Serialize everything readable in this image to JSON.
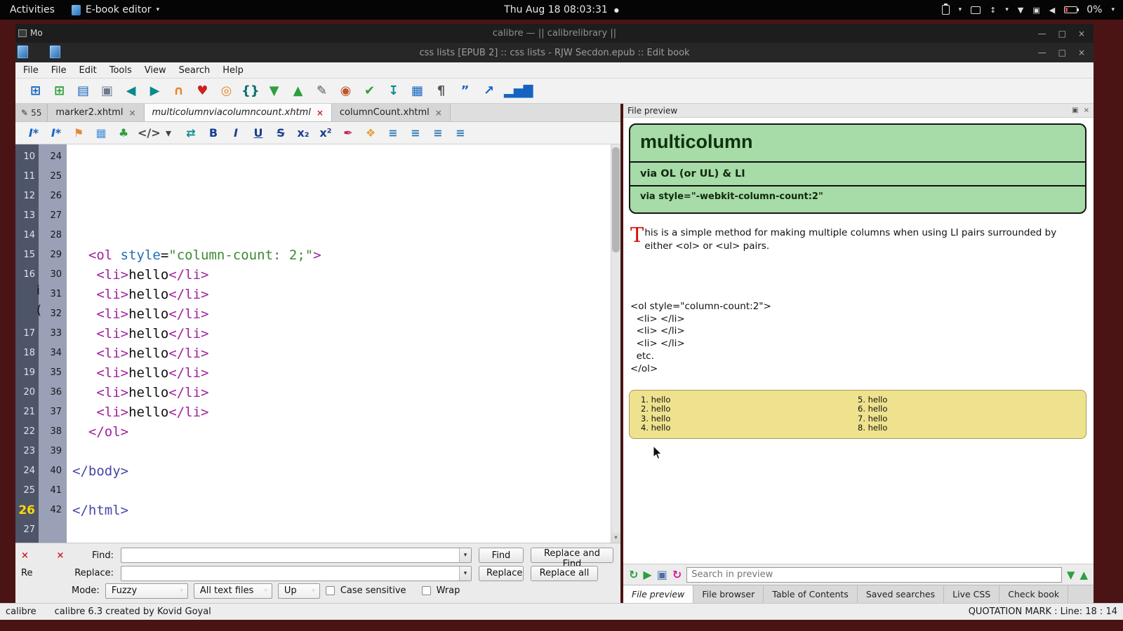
{
  "ui": {
    "chevron_down": "▾",
    "dot": "●",
    "minimize": "—",
    "maximize": "□",
    "close": "×",
    "pen": "✎",
    "down_arrow": "▼",
    "up_arrow": "▲",
    "updown": "↕",
    "net": "▼",
    "cam": "▣",
    "vol": "◀",
    "panel_grid": "▣",
    "panel_close": "×"
  },
  "topbar": {
    "activities": "Activities",
    "app_menu": "E-book editor",
    "clock": "Thu Aug 18 08:03:31",
    "battery_percent": "0%"
  },
  "titlebars": {
    "calibre": "calibre — || calibrelibrary ||",
    "editor": "css lists [EPUB 2] :: css lists - RJW Secdon.epub :: Edit book",
    "background_window_label": "Mo"
  },
  "menubar": {
    "items": [
      "File",
      "File",
      "Edit",
      "Tools",
      "View",
      "Search",
      "Help"
    ]
  },
  "main_toolbar": {
    "icons": [
      {
        "name": "add-book-icon",
        "glyph": "⊞",
        "color": "#1565c0"
      },
      {
        "name": "new-file-icon",
        "glyph": "⊞",
        "color": "#2e9e3f"
      },
      {
        "name": "open-book-icon",
        "glyph": "▤",
        "color": "#1565c0"
      },
      {
        "name": "save-icon",
        "glyph": "▣",
        "color": "#6b7a8c"
      },
      {
        "name": "back-icon",
        "glyph": "◀",
        "color": "#0a8a8a"
      },
      {
        "name": "forward-icon",
        "glyph": "▶",
        "color": "#0a8a8a"
      },
      {
        "name": "arc-icon",
        "glyph": "∩",
        "color": "#e8852c"
      },
      {
        "name": "donate-icon",
        "glyph": "♥",
        "color": "#cc2222"
      },
      {
        "name": "donut-icon",
        "glyph": "◎",
        "color": "#e8852c"
      },
      {
        "name": "braces-icon",
        "glyph": "{}",
        "color": "#0a7070"
      },
      {
        "name": "arrow-down-icon",
        "glyph": "▼",
        "color": "#2e9e3f"
      },
      {
        "name": "arrow-up-icon",
        "glyph": "▲",
        "color": "#2e9e3f"
      },
      {
        "name": "edit-icon",
        "glyph": "✎",
        "color": "#555555"
      },
      {
        "name": "bug-icon",
        "glyph": "◉",
        "color": "#c0522a"
      },
      {
        "name": "spellcheck-icon",
        "glyph": "✔",
        "color": "#2e9e3f"
      },
      {
        "name": "insert-icon",
        "glyph": "↧",
        "color": "#0a8a8a"
      },
      {
        "name": "image-icon",
        "glyph": "▦",
        "color": "#1565c0"
      },
      {
        "name": "paragraph-icon",
        "glyph": "¶",
        "color": "#555555"
      },
      {
        "name": "quote-icon",
        "glyph": "”",
        "color": "#1565c0"
      },
      {
        "name": "upload-icon",
        "glyph": "↗",
        "color": "#1565c0"
      },
      {
        "name": "chart-icon",
        "glyph": "▂▅▇",
        "color": "#1565c0"
      }
    ]
  },
  "tabbar": {
    "partial_tab": "55",
    "tabs": [
      {
        "label": "marker2.xhtml"
      },
      {
        "label": "multicolumnviacolumncount.xhtml",
        "cls": "active"
      },
      {
        "label": "columnCount.xhtml"
      }
    ]
  },
  "format_toolbar": {
    "icons": [
      {
        "name": "insert-link-icon",
        "glyph": "I*",
        "color": "#1565c0",
        "cls": "i"
      },
      {
        "name": "insert-anchor-icon",
        "glyph": "I*",
        "color": "#1565c0",
        "cls": "i"
      },
      {
        "name": "pin-icon",
        "glyph": "⚑",
        "color": "#e8852c"
      },
      {
        "name": "insert-image-icon",
        "glyph": "▦",
        "color": "#4a90d9"
      },
      {
        "name": "plant-icon",
        "glyph": "♣",
        "color": "#2e9e3f"
      },
      {
        "name": "code-tag-icon",
        "glyph": "</>",
        "color": "#444444"
      },
      {
        "name": "chevron-down-icon",
        "glyph": "▾",
        "color": "#444444"
      },
      {
        "name": "split-view-icon",
        "glyph": "⇄",
        "color": "#0a8a8a"
      },
      {
        "name": "bold-icon",
        "glyph": "B",
        "color": "#1a3f8f",
        "cls": "b"
      },
      {
        "name": "italic-icon",
        "glyph": "I",
        "color": "#1a3f8f",
        "cls": "i"
      },
      {
        "name": "underline-icon",
        "glyph": "U",
        "color": "#1a3f8f",
        "cls": "u"
      },
      {
        "name": "strikethrough-icon",
        "glyph": "S",
        "color": "#1a3f8f",
        "cls": "s"
      },
      {
        "name": "subscript-icon",
        "glyph": "x₂",
        "color": "#1a3f8f"
      },
      {
        "name": "superscript-icon",
        "glyph": "x²",
        "color": "#1a3f8f"
      },
      {
        "name": "brush-icon",
        "glyph": "✒",
        "color": "#c2185b"
      },
      {
        "name": "palette-icon",
        "glyph": "❖",
        "color": "#e8a13c"
      },
      {
        "name": "align-left-icon",
        "glyph": "≡",
        "color": "#2a7ab5"
      },
      {
        "name": "align-center-icon",
        "glyph": "≡",
        "color": "#2a7ab5"
      },
      {
        "name": "align-right-icon",
        "glyph": "≡",
        "color": "#2a7ab5"
      },
      {
        "name": "align-justify-icon",
        "glyph": "≡",
        "color": "#2a7ab5"
      }
    ]
  },
  "editor": {
    "left_gutter": [
      {
        "n": "10"
      },
      {
        "n": "11"
      },
      {
        "n": "12"
      },
      {
        "n": "13"
      },
      {
        "n": "14"
      },
      {
        "n": "15"
      },
      {
        "n": "16"
      },
      {
        "n": ""
      },
      {
        "n": ""
      },
      {
        "n": "17"
      },
      {
        "n": "18"
      },
      {
        "n": "19"
      },
      {
        "n": "20"
      },
      {
        "n": "21"
      },
      {
        "n": "22"
      },
      {
        "n": "23"
      },
      {
        "n": "24"
      },
      {
        "n": "25"
      },
      {
        "n": "26",
        "cls": "hl"
      },
      {
        "n": "27"
      }
    ],
    "stray_glyphs": [
      "i",
      "("
    ],
    "line_numbers": [
      "24",
      "25",
      "26",
      "27",
      "28",
      "29",
      "30",
      "31",
      "32",
      "33",
      "34",
      "35",
      "36",
      "37",
      "38",
      "39",
      "40",
      "41",
      "42"
    ],
    "code_lines": [
      [],
      [],
      [],
      [],
      [],
      [
        {
          "c": "tag",
          "t": "  <ol "
        },
        {
          "c": "attr",
          "t": "style"
        },
        {
          "c": "txt",
          "t": "="
        },
        {
          "c": "str",
          "t": "\"column-count: 2;\""
        },
        {
          "c": "tag",
          "t": ">"
        }
      ],
      [
        {
          "c": "tag",
          "t": "   <li>"
        },
        {
          "c": "txt",
          "t": "hello"
        },
        {
          "c": "tag",
          "t": "</li>"
        }
      ],
      [
        {
          "c": "tag",
          "t": "   <li>"
        },
        {
          "c": "txt",
          "t": "hello"
        },
        {
          "c": "tag",
          "t": "</li>"
        }
      ],
      [
        {
          "c": "tag",
          "t": "   <li>"
        },
        {
          "c": "txt",
          "t": "hello"
        },
        {
          "c": "tag",
          "t": "</li>"
        }
      ],
      [
        {
          "c": "tag",
          "t": "   <li>"
        },
        {
          "c": "txt",
          "t": "hello"
        },
        {
          "c": "tag",
          "t": "</li>"
        }
      ],
      [
        {
          "c": "tag",
          "t": "   <li>"
        },
        {
          "c": "txt",
          "t": "hello"
        },
        {
          "c": "tag",
          "t": "</li>"
        }
      ],
      [
        {
          "c": "tag",
          "t": "   <li>"
        },
        {
          "c": "txt",
          "t": "hello"
        },
        {
          "c": "tag",
          "t": "</li>"
        }
      ],
      [
        {
          "c": "tag",
          "t": "   <li>"
        },
        {
          "c": "txt",
          "t": "hello"
        },
        {
          "c": "tag",
          "t": "</li>"
        }
      ],
      [
        {
          "c": "tag",
          "t": "   <li>"
        },
        {
          "c": "txt",
          "t": "hello"
        },
        {
          "c": "tag",
          "t": "</li>"
        }
      ],
      [
        {
          "c": "tag",
          "t": "  </ol>"
        }
      ],
      [],
      [
        {
          "c": "tag2",
          "t": "</body>"
        }
      ],
      [],
      [
        {
          "c": "tag2",
          "t": "</html>"
        }
      ]
    ]
  },
  "find_panel": {
    "partial_row2": "Re",
    "find_label": "Find:",
    "replace_label": "Replace:",
    "find_button": "Find",
    "replace_and_find_button": "Replace and Find",
    "replace_button": "Replace",
    "replace_all_button": "Replace all",
    "mode_label": "Mode:",
    "mode_value": "Fuzzy",
    "scope_value": "All text files",
    "direction_value": "Up",
    "case_sensitive_label": "Case sensitive",
    "wrap_label": "Wrap"
  },
  "preview": {
    "header": "File preview",
    "hero": {
      "title": "multicolumn",
      "sub1": "via OL (or UL) & LI",
      "sub2": "via style=\"-webkit-column-count:2\""
    },
    "para": {
      "dropcap": "T",
      "text": "his is a simple method for making multiple columns when using LI pairs surrounded by either <ol> or <ul> pairs."
    },
    "code_block": [
      "<ol style=\"column-count:2\">",
      "  <li> </li>",
      "  <li> </li>",
      "  <li> </li>",
      "  etc.",
      "</ol>"
    ],
    "list_left": [
      "1. hello",
      "2. hello",
      "3. hello",
      "4. hello"
    ],
    "list_right": [
      "5. hello",
      "6. hello",
      "7. hello",
      "8. hello"
    ],
    "search_placeholder": "Search in preview",
    "search_icons": [
      {
        "name": "refresh-preview-icon",
        "glyph": "↻",
        "color": "#2e9e3f"
      },
      {
        "name": "run-preview-icon",
        "glyph": "▶",
        "color": "#2e9e3f"
      },
      {
        "name": "save-preview-icon",
        "glyph": "▣",
        "color": "#4a6fa5"
      },
      {
        "name": "reload-preview-icon",
        "glyph": "↻",
        "color": "#d81b9a"
      }
    ]
  },
  "bottom_tabs": {
    "tabs": [
      {
        "label": "File preview",
        "cls": "active"
      },
      {
        "label": "File browser"
      },
      {
        "label": "Table of Contents"
      },
      {
        "label": "Saved searches"
      },
      {
        "label": "Live CSS"
      },
      {
        "label": "Check book"
      }
    ]
  },
  "statusbar": {
    "app": "calibre",
    "message": "calibre 6.3 created by Kovid Goyal",
    "cursor_info": "QUOTATION MARK : Line: 18 : 14"
  }
}
